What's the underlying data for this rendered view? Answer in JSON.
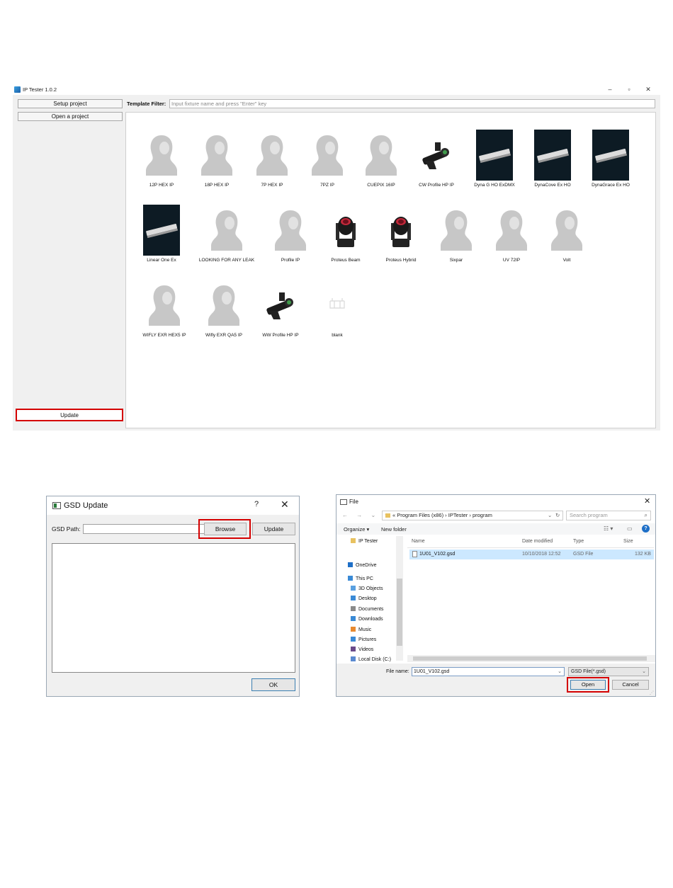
{
  "app": {
    "title": "IP Tester 1.0.2",
    "window_controls": {
      "minimize": "–",
      "maximize": "▫",
      "close": "✕"
    },
    "buttons": {
      "setup": "Setup project",
      "open": "Open a project",
      "update": "Update"
    },
    "filter": {
      "label": "Template Filter:",
      "placeholder": "Input fixture name and press \"Enter\" key"
    },
    "fixtures": [
      {
        "name": "12P HEX IP",
        "icon": "placeholder-head-icon"
      },
      {
        "name": "18P HEX IP",
        "icon": "placeholder-head-icon"
      },
      {
        "name": "7P HEX IP",
        "icon": "placeholder-head-icon"
      },
      {
        "name": "7PZ IP",
        "icon": "placeholder-head-icon"
      },
      {
        "name": "CUEPIX 16IP",
        "icon": "placeholder-head-icon"
      },
      {
        "name": "CW Profile HP IP",
        "icon": "profile-fixture-icon"
      },
      {
        "name": "Dyna G HO ExDMX",
        "icon": "linear-bar-icon"
      },
      {
        "name": "DynaCove Ex HO",
        "icon": "linear-bar-icon"
      },
      {
        "name": "DynaGrace Ex HO",
        "icon": "linear-bar-icon"
      },
      {
        "name": "Linear One Ex",
        "icon": "linear-bar-icon"
      },
      {
        "name": "LOOKING FOR ANY LEAK",
        "icon": "placeholder-head-icon"
      },
      {
        "name": "Profile IP",
        "icon": "placeholder-head-icon"
      },
      {
        "name": "Proteus Beam",
        "icon": "moving-head-icon"
      },
      {
        "name": "Proteus Hybrid",
        "icon": "moving-head-icon"
      },
      {
        "name": "Sixpar",
        "icon": "placeholder-head-icon"
      },
      {
        "name": "UV 72IP",
        "icon": "placeholder-head-icon"
      },
      {
        "name": "Volt",
        "icon": "placeholder-head-icon"
      },
      {
        "name": "WIFLY EXR HEX5 IP",
        "icon": "placeholder-head-icon"
      },
      {
        "name": "Wifly EXR QA5 IP",
        "icon": "placeholder-head-icon"
      },
      {
        "name": "WW Profile HP IP",
        "icon": "profile-fixture-icon"
      },
      {
        "name": "blank",
        "icon": "blank-icon"
      }
    ]
  },
  "gsd_dialog": {
    "title": "GSD Update",
    "help": "?",
    "close": "✕",
    "path_label": "GSD Path:",
    "path_value": "",
    "browse": "Browse",
    "update": "Update",
    "ok": "OK"
  },
  "file_dialog": {
    "title": "File",
    "close": "✕",
    "nav": "← → ⌄ ↑",
    "breadcrumb": "« Program Files (x86) › IPTester › program",
    "address_dropdown": "⌄",
    "refresh": "↻",
    "search_placeholder": "Search program",
    "search_icon": "⌕",
    "toolbar": {
      "organize": "Organize ▾",
      "new_folder": "New folder",
      "view": "☷ ▾",
      "preview": "▭",
      "help": "?"
    },
    "tree": [
      {
        "label": "IP Tester",
        "icon": "folder-icon",
        "color": "#e8c260"
      },
      {
        "label": "OneDrive",
        "icon": "onedrive-icon",
        "color": "#1e6fc7"
      },
      {
        "label": "This PC",
        "icon": "pc-icon",
        "color": "#3a8ad6"
      },
      {
        "label": "3D Objects",
        "icon": "objects-icon",
        "color": "#5aa0e0"
      },
      {
        "label": "Desktop",
        "icon": "desktop-icon",
        "color": "#3a8ad6"
      },
      {
        "label": "Documents",
        "icon": "documents-icon",
        "color": "#8a8a8a"
      },
      {
        "label": "Downloads",
        "icon": "downloads-icon",
        "color": "#3a8ad6"
      },
      {
        "label": "Music",
        "icon": "music-icon",
        "color": "#e88a30"
      },
      {
        "label": "Pictures",
        "icon": "pictures-icon",
        "color": "#3a8ad6"
      },
      {
        "label": "Videos",
        "icon": "videos-icon",
        "color": "#6a4a8a"
      },
      {
        "label": "Local Disk (C:)",
        "icon": "disk-icon",
        "color": "#5a8ad0"
      }
    ],
    "columns": {
      "name": "Name",
      "date": "Date modified",
      "type": "Type",
      "size": "Size"
    },
    "files": [
      {
        "name": "1U01_V102.gsd",
        "date": "10/10/2018 12:52",
        "type": "GSD File",
        "size": "132 KB"
      }
    ],
    "file_name_label": "File name:",
    "file_name_value": "1U01_V102.gsd",
    "file_type": "GSD File(*.gsd)",
    "open": "Open",
    "cancel": "Cancel"
  },
  "colors": {
    "highlight_red": "#d40000",
    "selection_blue": "#cce8ff",
    "accent_blue": "#1e6fc7"
  }
}
